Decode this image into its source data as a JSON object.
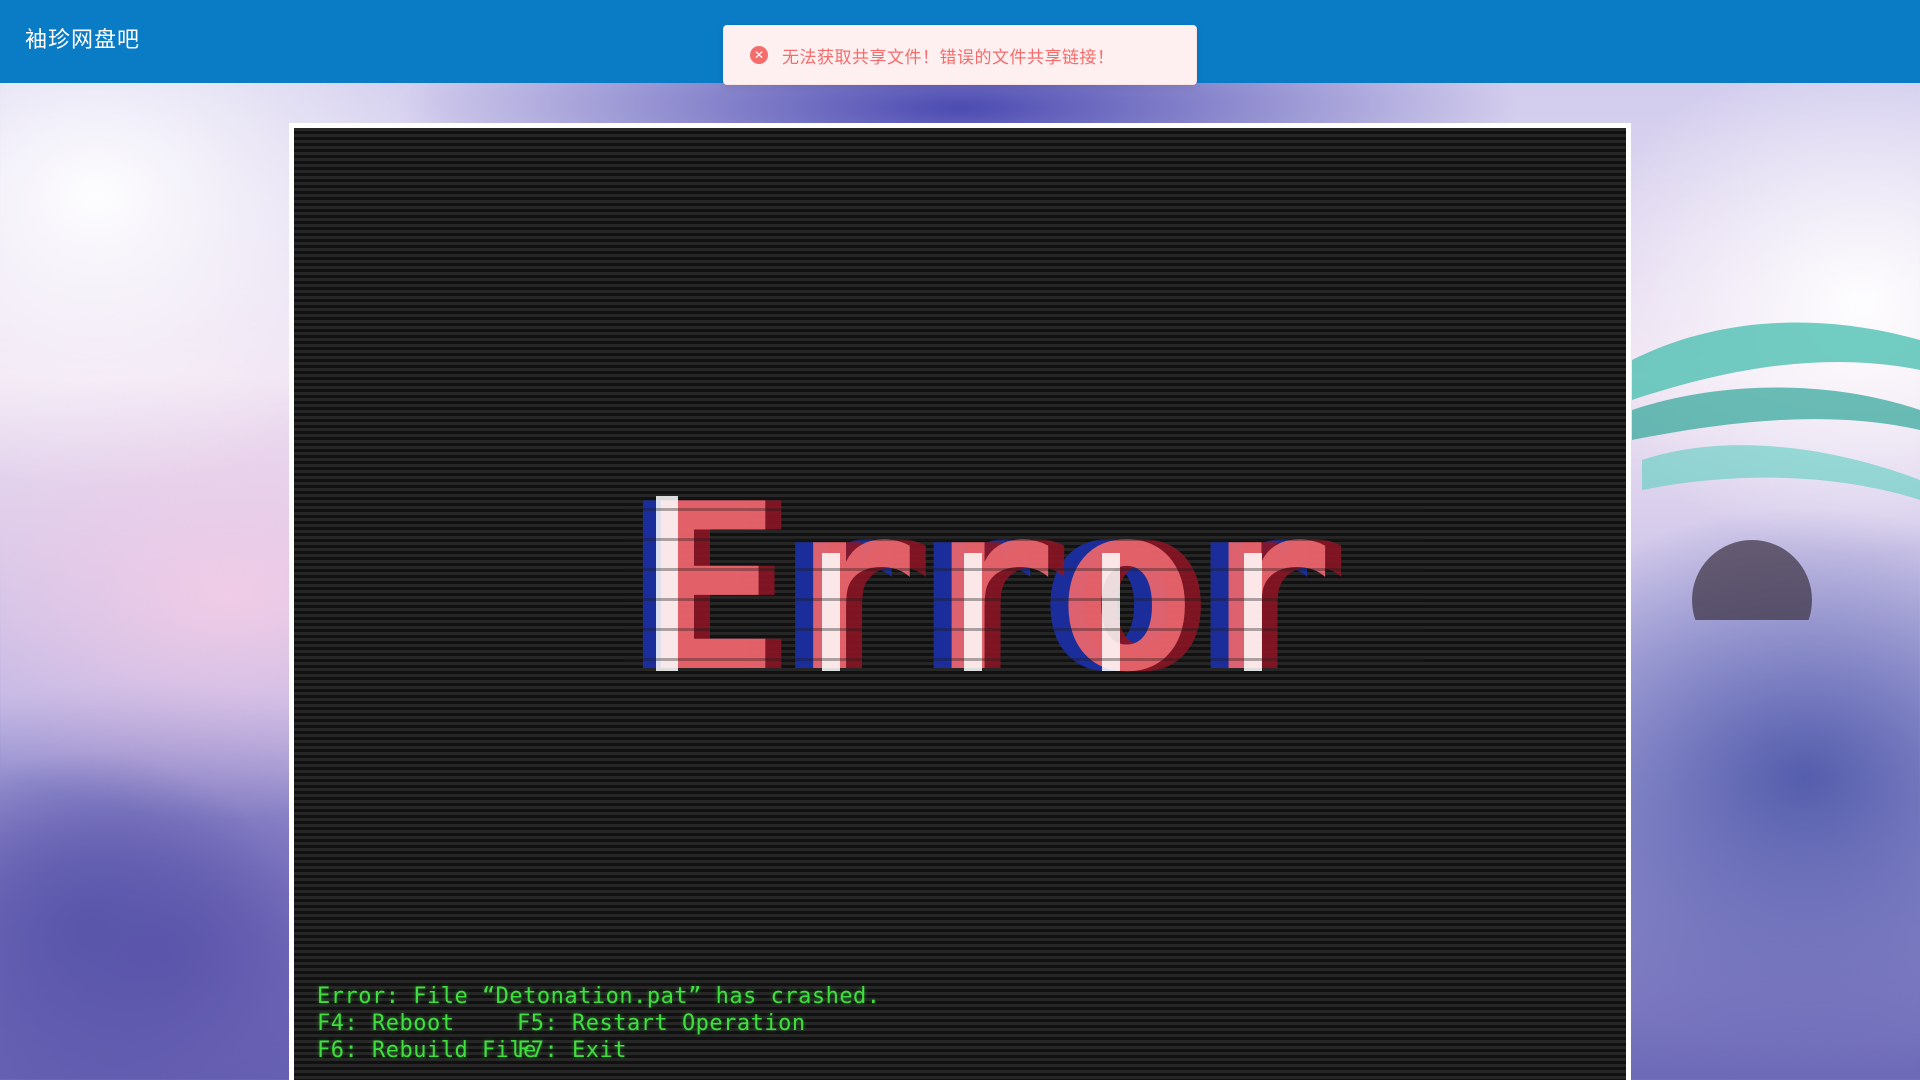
{
  "header": {
    "site_title": "袖珍网盘吧"
  },
  "notification": {
    "type": "error",
    "icon": "close-circle-icon",
    "message": "无法获取共享文件！错误的文件共享链接！"
  },
  "error_screen": {
    "headline": "Error",
    "console": {
      "error_line": "Error: File “Detonation.pat” has crashed.",
      "options": [
        [
          "F4: Reboot",
          "F5: Restart Operation"
        ],
        [
          "F6: Rebuild File",
          "F7: Exit"
        ]
      ]
    }
  },
  "colors": {
    "header_bg": "#0a7bc5",
    "toast_bg": "#fef0f0",
    "toast_text": "#f56c6c",
    "console_text": "#3ee03e",
    "glitch_red": "#e8646c",
    "glitch_blue": "#1a2d9a"
  }
}
